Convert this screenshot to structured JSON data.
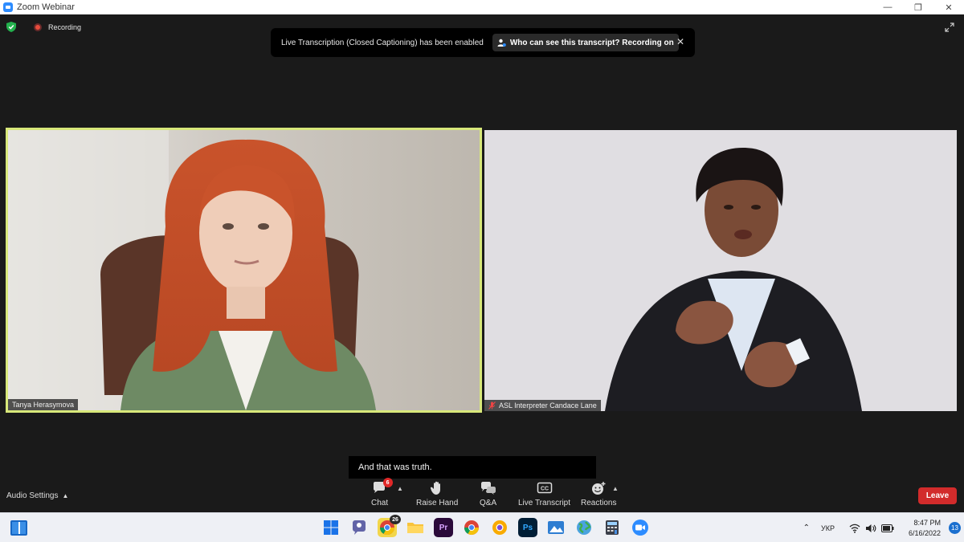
{
  "window": {
    "title": "Zoom Webinar"
  },
  "status": {
    "recording_label": "Recording"
  },
  "banner": {
    "message": "Live Transcription (Closed Captioning) has been enabled",
    "link_label": "Who can see this transcript? Recording on"
  },
  "participants": [
    {
      "name": "Tanya Herasymova"
    },
    {
      "name": "ASL Interpreter Candace Lane"
    }
  ],
  "caption": {
    "text": "And that was truth."
  },
  "toolbar": {
    "audio_settings": "Audio Settings",
    "chat": "Chat",
    "chat_badge": "6",
    "raise_hand": "Raise Hand",
    "qa": "Q&A",
    "live_transcript": "Live Transcript",
    "cc": "CC",
    "reactions": "Reactions",
    "leave": "Leave"
  },
  "taskbar": {
    "language": "УКР",
    "time": "8:47 PM",
    "date": "6/16/2022",
    "notifications": "13",
    "app_badge": "26",
    "premiere_label": "Pr",
    "photoshop_label": "Ps"
  },
  "colors": {
    "active_speaker_border": "#d8e87a",
    "leave": "#d22b2b",
    "badge": "#e02828",
    "recording": "#e74c3c"
  }
}
